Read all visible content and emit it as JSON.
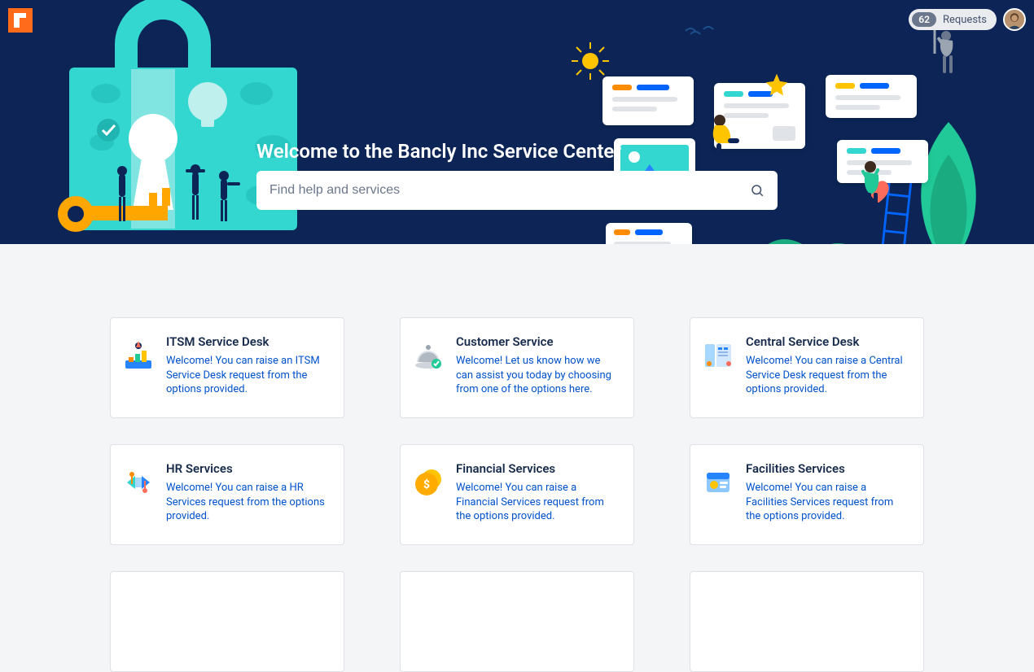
{
  "header": {
    "requests_count": "62",
    "requests_label": "Requests"
  },
  "hero": {
    "title": "Welcome to the Bancly Inc Service Center",
    "search_placeholder": "Find help and services"
  },
  "cards": [
    {
      "title": "ITSM Service Desk",
      "desc": "Welcome! You can raise an ITSM Service Desk request from the options provided."
    },
    {
      "title": "Customer Service",
      "desc": "Welcome! Let us know how we can assist you today by choosing from one of the options here."
    },
    {
      "title": "Central Service Desk",
      "desc": "Welcome! You can raise a Central Service Desk request from the options provided."
    },
    {
      "title": "HR Services",
      "desc": "Welcome! You can raise a HR Services request from the options provided."
    },
    {
      "title": "Financial Services",
      "desc": "Welcome! You can raise a Financial Services request from the options provided."
    },
    {
      "title": "Facilities Services",
      "desc": "Welcome! You can raise a Facilities Services request from the options provided."
    }
  ]
}
